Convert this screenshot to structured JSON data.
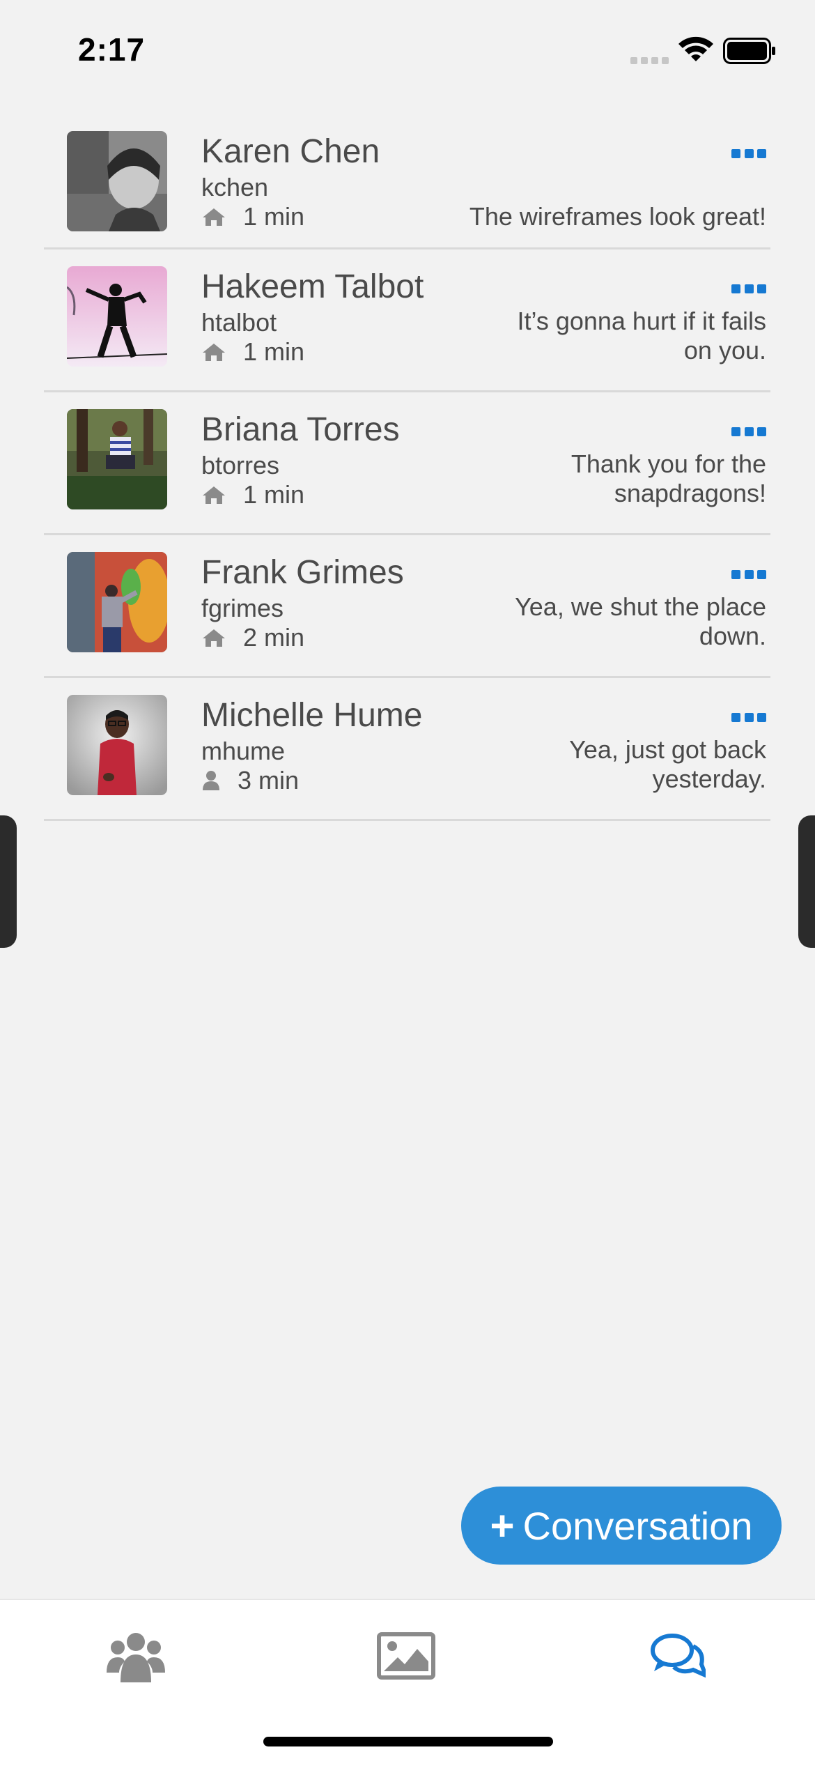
{
  "status_bar": {
    "time": "2:17"
  },
  "conversations": [
    {
      "name": "Karen Chen",
      "handle": "kchen",
      "location_icon": "home-icon",
      "time": "1 min",
      "message": "The wireframes look great!"
    },
    {
      "name": "Hakeem Talbot",
      "handle": "htalbot",
      "location_icon": "home-icon",
      "time": "1 min",
      "message": "It’s gonna hurt if it fails on you."
    },
    {
      "name": "Briana Torres",
      "handle": "btorres",
      "location_icon": "home-icon",
      "time": "1 min",
      "message": "Thank you for the snapdragons!"
    },
    {
      "name": "Frank Grimes",
      "handle": "fgrimes",
      "location_icon": "home-icon",
      "time": "2 min",
      "message": "Yea, we shut the place down."
    },
    {
      "name": "Michelle Hume",
      "handle": "mhume",
      "location_icon": "user-icon",
      "time": "3 min",
      "message": "Yea, just got back yesterday."
    }
  ],
  "fab": {
    "icon": "plus-icon",
    "label": "Conversation"
  },
  "tabs": [
    {
      "icon": "users-icon",
      "active": false
    },
    {
      "icon": "image-icon",
      "active": false
    },
    {
      "icon": "comments-icon",
      "active": true
    }
  ],
  "colors": {
    "accent": "#1679d2",
    "fab": "#2d8fd8",
    "background": "#f2f2f2",
    "inactive_icon": "#8a8a8a"
  }
}
